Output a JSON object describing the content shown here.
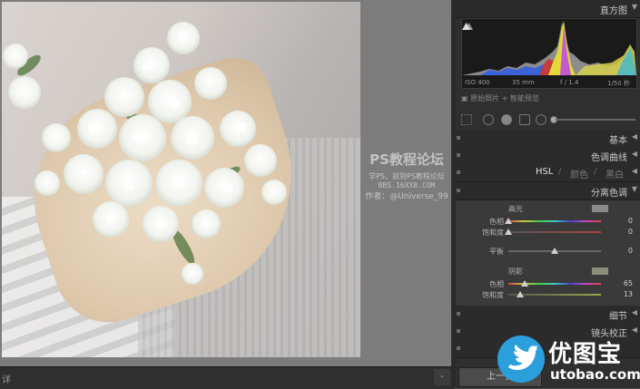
{
  "canvas": {
    "bottom_label": "详",
    "dropdown_label": "-"
  },
  "watermark": {
    "line1": "PS教程论坛",
    "line2": "学PS，就到PS教程论坛",
    "line3": "BBS.16XX8.COM",
    "line4": "作者：@Universe_99"
  },
  "panel": {
    "histogram": {
      "title": "直方图",
      "iso": "ISO 400",
      "focal": "35 mm",
      "aperture": "f / 1.4",
      "shutter": "1/50 秒"
    },
    "original_photo": "原始照片",
    "smart_preview": "智能预览",
    "sections": {
      "basic": "基本",
      "tone_curve": "色调曲线",
      "hsl": {
        "hsl": "HSL",
        "color": "颜色",
        "bw": "黑白"
      },
      "split_toning": "分离色调",
      "detail": "细节",
      "lens": "镜头校正"
    },
    "split_toning": {
      "highlights": {
        "title": "高光",
        "color": "#8a8a88",
        "hue_label": "色相",
        "hue": "0",
        "hue_level": 0,
        "sat_label": "饱和度",
        "sat": "0",
        "sat_level": 0
      },
      "balance": {
        "label": "平衡",
        "value": "0",
        "level": 50
      },
      "shadows": {
        "title": "阴影",
        "color": "#8a9078",
        "hue_label": "色相",
        "hue": "65",
        "hue_level": 18,
        "sat_label": "饱和度",
        "sat": "13",
        "sat_level": 13
      }
    },
    "prev_button": "上一张"
  },
  "logo": {
    "big": "优图宝",
    "small": "utobao.com",
    "color": "#2a9fdc"
  }
}
